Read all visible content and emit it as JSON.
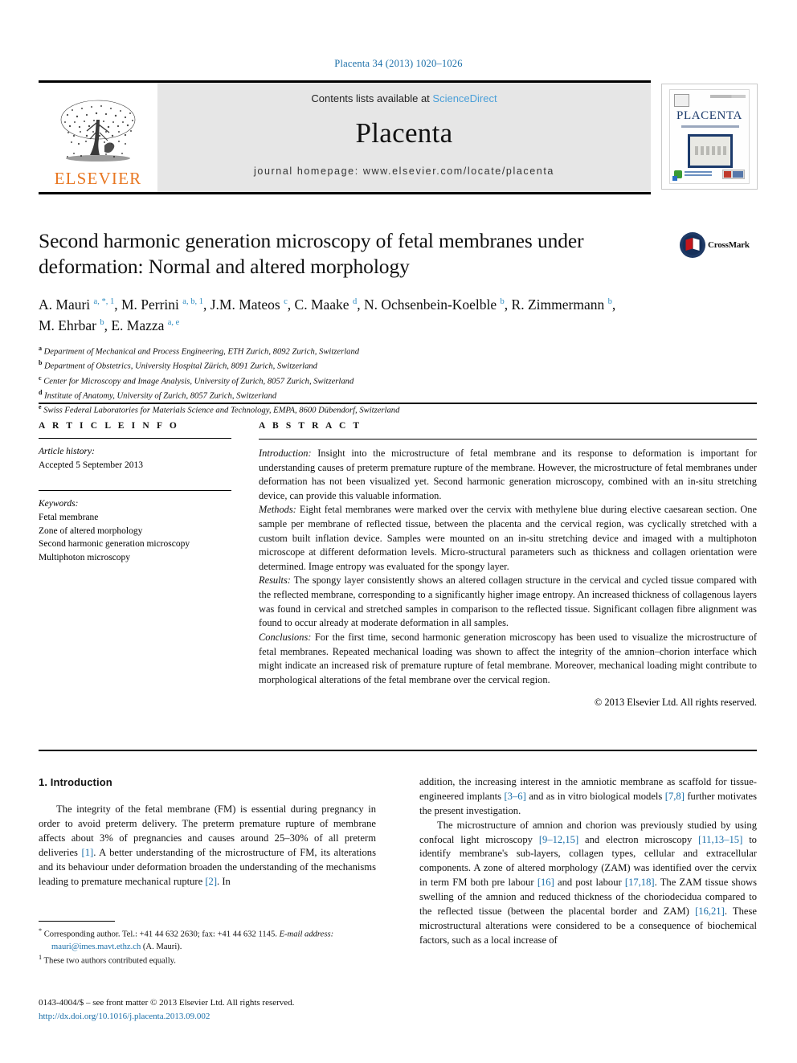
{
  "running_head": "Placenta 34 (2013) 1020–1026",
  "masthead": {
    "publisher": "ELSEVIER",
    "contents_prefix": "Contents lists available at ",
    "contents_link": "ScienceDirect",
    "journal_name": "Placenta",
    "homepage": "journal homepage: www.elsevier.com/locate/placenta",
    "cover_title": "PLACENTA"
  },
  "crossmark": {
    "label": "CrossMark"
  },
  "article": {
    "title": "Second harmonic generation microscopy of fetal membranes under deformation: Normal and altered morphology",
    "authors_html": "A. Mauri <sup>a, *, 1</sup>, M. Perrini <sup>a, b, 1</sup>, J.M. Mateos <sup>c</sup>, C. Maake <sup>d</sup>, N. Ochsenbein-Koelble <sup>b</sup>, R. Zimmermann <sup>b</sup>, M. Ehrbar <sup>b</sup>, E. Mazza <sup>a, e</sup>",
    "affiliations": [
      {
        "mark": "a",
        "text": "Department of Mechanical and Process Engineering, ETH Zurich, 8092 Zurich, Switzerland"
      },
      {
        "mark": "b",
        "text": "Department of Obstetrics, University Hospital Zürich, 8091 Zurich, Switzerland"
      },
      {
        "mark": "c",
        "text": "Center for Microscopy and Image Analysis, University of Zurich, 8057 Zurich, Switzerland"
      },
      {
        "mark": "d",
        "text": "Institute of Anatomy, University of Zurich, 8057 Zurich, Switzerland"
      },
      {
        "mark": "e",
        "text": "Swiss Federal Laboratories for Materials Science and Technology, EMPA, 8600 Dübendorf, Switzerland"
      }
    ]
  },
  "article_info": {
    "heading": "A R T I C L E   I N F O",
    "history_label": "Article history:",
    "history_value": "Accepted 5 September 2013",
    "keywords_label": "Keywords:",
    "keywords": [
      "Fetal membrane",
      "Zone of altered morphology",
      "Second harmonic generation microscopy",
      "Multiphoton microscopy"
    ]
  },
  "abstract": {
    "heading": "A B S T R A C T",
    "sections": [
      {
        "label": "Introduction:",
        "text": " Insight into the microstructure of fetal membrane and its response to deformation is important for understanding causes of preterm premature rupture of the membrane. However, the microstructure of fetal membranes under deformation has not been visualized yet. Second harmonic generation microscopy, combined with an in-situ stretching device, can provide this valuable information."
      },
      {
        "label": "Methods:",
        "text": " Eight fetal membranes were marked over the cervix with methylene blue during elective caesarean section. One sample per membrane of reflected tissue, between the placenta and the cervical region, was cyclically stretched with a custom built inflation device. Samples were mounted on an in-situ stretching device and imaged with a multiphoton microscope at different deformation levels. Micro-structural parameters such as thickness and collagen orientation were determined. Image entropy was evaluated for the spongy layer."
      },
      {
        "label": "Results:",
        "text": " The spongy layer consistently shows an altered collagen structure in the cervical and cycled tissue compared with the reflected membrane, corresponding to a significantly higher image entropy. An increased thickness of collagenous layers was found in cervical and stretched samples in comparison to the reflected tissue. Significant collagen fibre alignment was found to occur already at moderate deformation in all samples."
      },
      {
        "label": "Conclusions:",
        "text": " For the first time, second harmonic generation microscopy has been used to visualize the microstructure of fetal membranes. Repeated mechanical loading was shown to affect the integrity of the amnion–chorion interface which might indicate an increased risk of premature rupture of fetal membrane. Moreover, mechanical loading might contribute to morphological alterations of the fetal membrane over the cervical region."
      }
    ],
    "copyright": "© 2013 Elsevier Ltd. All rights reserved."
  },
  "body": {
    "section_heading": "1. Introduction",
    "left_paragraph_parts": [
      "The integrity of the fetal membrane (FM) is essential during pregnancy in order to avoid preterm delivery. The preterm premature rupture of membrane affects about 3% of pregnancies and causes around 25–30% of all preterm deliveries ",
      "[1]",
      ". A better understanding of the microstructure of FM, its alterations and its behaviour under deformation broaden the understanding of the mechanisms leading to premature mechanical rupture ",
      "[2]",
      ". In"
    ],
    "right_paragraph1_parts": [
      "addition, the increasing interest in the amniotic membrane as scaffold for tissue-engineered implants ",
      "[3–6]",
      " and as in vitro biological models ",
      "[7,8]",
      " further motivates the present investigation."
    ],
    "right_paragraph2_parts": [
      "The microstructure of amnion and chorion was previously studied by using confocal light microscopy ",
      "[9–12,15]",
      " and electron microscopy ",
      "[11,13–15]",
      " to identify membrane's sub-layers, collagen types, cellular and extracellular components. A zone of altered morphology (ZAM) was identified over the cervix in term FM both pre labour ",
      "[16]",
      " and post labour ",
      "[17,18]",
      ". The ZAM tissue shows swelling of the amnion and reduced thickness of the choriodecidua compared to the reflected tissue (between the placental border and ZAM) ",
      "[16,21]",
      ". These microstructural alterations were considered to be a consequence of biochemical factors, such as a local increase of"
    ]
  },
  "footnotes": {
    "corresponding_mark": "*",
    "corresponding_text": " Corresponding author. Tel.: +41 44 632 2630; fax: +41 44 632 1145.",
    "email_label": "E-mail address:",
    "email": "mauri@imes.mavt.ethz.ch",
    "email_suffix": " (A. Mauri).",
    "equal_mark": "1",
    "equal_text": " These two authors contributed equally."
  },
  "imprint": {
    "line1": "0143-4004/$ – see front matter © 2013 Elsevier Ltd. All rights reserved.",
    "doi": "http://dx.doi.org/10.1016/j.placenta.2013.09.002"
  },
  "colors": {
    "link": "#1a6ea8",
    "science_direct": "#4a9fd8",
    "elsevier_orange": "#e87722",
    "affil_mark": "#2d8bc0",
    "masthead_bg": "#e6e6e6"
  }
}
